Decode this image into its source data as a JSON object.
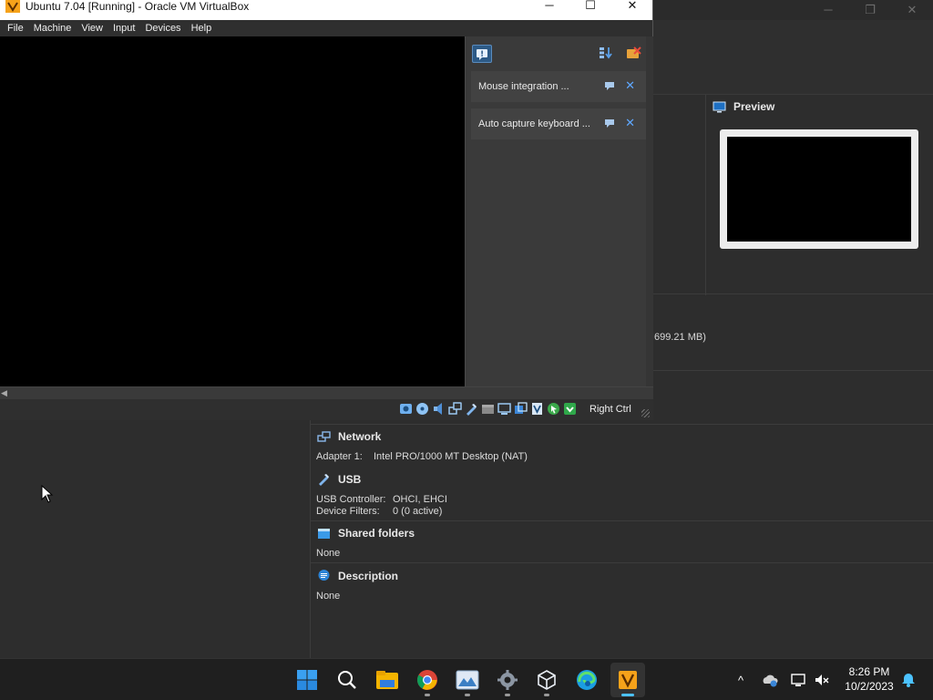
{
  "vm_window": {
    "title": "Ubuntu 7.04 [Running] - Oracle VM VirtualBox",
    "controls": {
      "minimize": "─",
      "maximize": "☐",
      "close": "✕"
    },
    "menu": [
      "File",
      "Machine",
      "View",
      "Input",
      "Devices",
      "Help"
    ],
    "notifications": [
      {
        "text": "Mouse integration ..."
      },
      {
        "text": "Auto capture keyboard ..."
      }
    ],
    "host_key": "Right Ctrl"
  },
  "manager": {
    "controls": {
      "minimize": "─",
      "maximize": "❐",
      "close": "✕"
    },
    "preview": {
      "title": "Preview"
    },
    "memory_text": "699.21 MB)",
    "network": {
      "title": "Network",
      "rows": [
        {
          "key": "Adapter 1:",
          "value": "Intel PRO/1000 MT Desktop (NAT)"
        }
      ]
    },
    "usb": {
      "title": "USB",
      "rows": [
        {
          "key": "USB Controller:",
          "value": "OHCI, EHCI"
        },
        {
          "key": "Device Filters:",
          "value": "0 (0 active)"
        }
      ]
    },
    "shared_folders": {
      "title": "Shared folders",
      "value": "None"
    },
    "description": {
      "title": "Description",
      "value": "None"
    }
  },
  "taskbar": {
    "time": "8:26 PM",
    "date": "10/2/2023",
    "tray_chevron": "^"
  },
  "colors": {
    "accent": "#4cc2ff",
    "panel_bg": "#3a3a3a",
    "window_bg": "#2d2d2d",
    "taskbar_bg": "#1f1f1f"
  }
}
